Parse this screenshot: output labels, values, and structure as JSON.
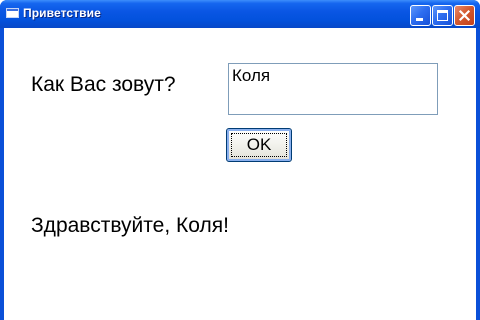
{
  "window": {
    "title": "Приветствие",
    "titlebar_color": "#0a56e4",
    "controls": {
      "minimize_icon": "minimize-icon",
      "maximize_icon": "maximize-icon",
      "close_icon": "close-icon"
    }
  },
  "form": {
    "question_label": "Как Вас зовут?",
    "name_value": "Коля",
    "ok_label": "OK",
    "greeting": "Здравствуйте, Коля!"
  }
}
